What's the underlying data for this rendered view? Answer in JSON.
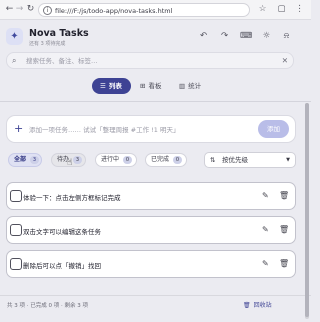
{
  "browser": {
    "url": "file:///F:/js/todo-app/nova-tasks.html"
  },
  "app": {
    "logo_glyph": "✦",
    "title": "Nova Tasks",
    "subtitle": "还有 3 项待完成"
  },
  "search": {
    "placeholder": "搜索任务、备注、标签…"
  },
  "views": [
    {
      "label": "列表",
      "icon": "list-icon",
      "active": true
    },
    {
      "label": "看板",
      "icon": "board-icon",
      "active": false
    },
    {
      "label": "统计",
      "icon": "stats-icon",
      "active": false
    }
  ],
  "add": {
    "placeholder": "添加一项任务…… 试试「整理周报 #工作 !1 明天」",
    "button_label": "添加"
  },
  "filters": [
    {
      "label": "全部",
      "count": "3",
      "active": true
    },
    {
      "label": "待办",
      "count": "3",
      "active": false
    },
    {
      "label": "进行中",
      "count": "0",
      "active": false
    },
    {
      "label": "已完成",
      "count": "0",
      "active": false
    }
  ],
  "sort": {
    "value": "按优先级"
  },
  "tasks": [
    {
      "text": "体验一下：点击左侧方框标记完成"
    },
    {
      "text": "双击文字可以编辑这条任务"
    },
    {
      "text": "删除后可以点「撤销」找回"
    }
  ],
  "footer": {
    "stats": "共 3 项 · 已完成 0 项 · 剩余 3 项",
    "trash_label": "回收站"
  },
  "colors": {
    "accent": "#3e4394",
    "accent_light": "#b9bde8",
    "background": "#ebebf1"
  }
}
